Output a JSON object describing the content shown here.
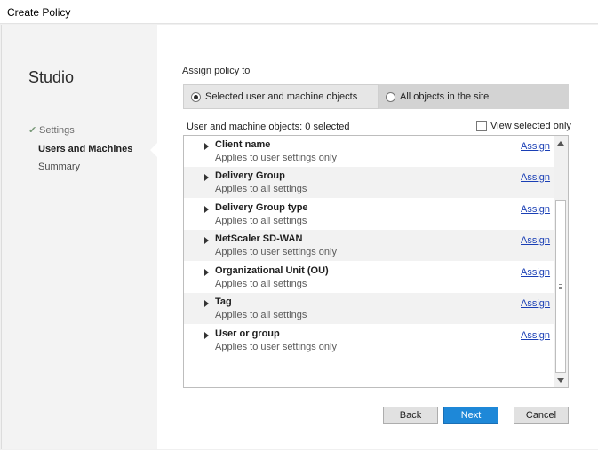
{
  "window": {
    "title": "Create Policy"
  },
  "sidebar": {
    "brand": "Studio",
    "items": [
      {
        "label": "Settings",
        "state": "done",
        "icon": "checkmark-icon"
      },
      {
        "label": "Users and Machines",
        "state": "active"
      },
      {
        "label": "Summary",
        "state": "pending"
      }
    ]
  },
  "assign": {
    "label": "Assign policy to",
    "options": [
      {
        "label": "Selected user and machine objects",
        "selected": true
      },
      {
        "label": "All objects in the site",
        "selected": false
      }
    ]
  },
  "objects": {
    "header": "User and machine objects: 0 selected",
    "view_selected_label": "View selected only",
    "view_selected_checked": false,
    "rows": [
      {
        "name": "Client name",
        "desc": "Applies to user settings only",
        "action": "Assign"
      },
      {
        "name": "Delivery Group",
        "desc": "Applies to all settings",
        "action": "Assign"
      },
      {
        "name": "Delivery Group type",
        "desc": "Applies to all settings",
        "action": "Assign"
      },
      {
        "name": "NetScaler SD-WAN",
        "desc": "Applies to user settings only",
        "action": "Assign"
      },
      {
        "name": "Organizational Unit (OU)",
        "desc": "Applies to all settings",
        "action": "Assign"
      },
      {
        "name": "Tag",
        "desc": "Applies to all settings",
        "action": "Assign"
      },
      {
        "name": "User or group",
        "desc": "Applies to user settings only",
        "action": "Assign"
      }
    ]
  },
  "footer": {
    "back_label": "Back",
    "next_label": "Next",
    "cancel_label": "Cancel"
  },
  "colors": {
    "accent": "#1e88d8",
    "link": "#1a3fb5"
  }
}
